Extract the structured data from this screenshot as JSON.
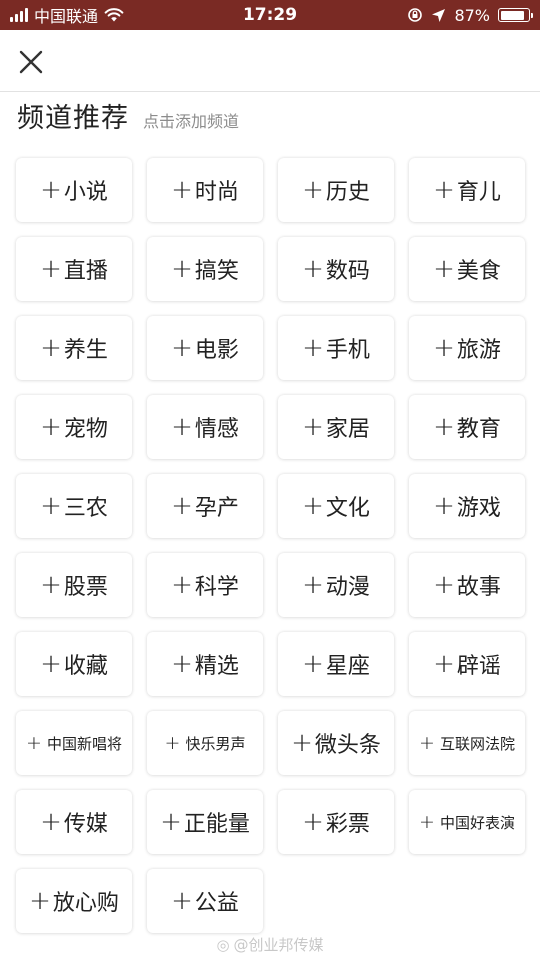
{
  "status_bar": {
    "carrier": "中国联通",
    "time": "17:29",
    "battery": "87%",
    "battery_level": 0.87
  },
  "header": {
    "close_icon": "close-icon"
  },
  "section": {
    "title": "频道推荐",
    "hint": "点击添加频道"
  },
  "plus_symbol": "+",
  "channels": [
    {
      "label": "小说"
    },
    {
      "label": "时尚"
    },
    {
      "label": "历史"
    },
    {
      "label": "育儿"
    },
    {
      "label": "直播"
    },
    {
      "label": "搞笑"
    },
    {
      "label": "数码"
    },
    {
      "label": "美食"
    },
    {
      "label": "养生"
    },
    {
      "label": "电影"
    },
    {
      "label": "手机"
    },
    {
      "label": "旅游"
    },
    {
      "label": "宠物"
    },
    {
      "label": "情感"
    },
    {
      "label": "家居"
    },
    {
      "label": "教育"
    },
    {
      "label": "三农"
    },
    {
      "label": "孕产"
    },
    {
      "label": "文化"
    },
    {
      "label": "游戏"
    },
    {
      "label": "股票"
    },
    {
      "label": "科学"
    },
    {
      "label": "动漫"
    },
    {
      "label": "故事"
    },
    {
      "label": "收藏"
    },
    {
      "label": "精选"
    },
    {
      "label": "星座"
    },
    {
      "label": "辟谣"
    },
    {
      "label": "中国新唱将"
    },
    {
      "label": "快乐男声"
    },
    {
      "label": "微头条"
    },
    {
      "label": "互联网法院"
    },
    {
      "label": "传媒"
    },
    {
      "label": "正能量"
    },
    {
      "label": "彩票"
    },
    {
      "label": "中国好表演"
    },
    {
      "label": "放心购"
    },
    {
      "label": "公益"
    }
  ],
  "watermark": "@创业邦传媒"
}
